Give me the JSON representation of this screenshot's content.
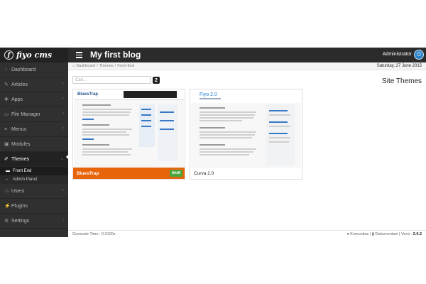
{
  "topbar": {
    "logo_text": "fiyo cms",
    "logo_mark": "f",
    "title": "My first blog",
    "user": "Administrator"
  },
  "sidebar": {
    "items": [
      {
        "label": "Dashboard",
        "icon": "dashboard-icon",
        "chevron": false
      },
      {
        "label": "Articles",
        "icon": "pencil-icon",
        "chevron": true
      },
      {
        "label": "Apps",
        "icon": "puzzle-icon",
        "chevron": true
      },
      {
        "label": "File Manager",
        "icon": "folder-icon",
        "chevron": true
      },
      {
        "label": "Menus",
        "icon": "list-icon",
        "chevron": true
      },
      {
        "label": "Modules",
        "icon": "cube-icon",
        "chevron": false
      },
      {
        "label": "Themes",
        "icon": "brush-icon",
        "chevron": true,
        "active": true
      },
      {
        "label": "Users",
        "icon": "user-icon",
        "chevron": true
      },
      {
        "label": "Plugins",
        "icon": "plug-icon",
        "chevron": false
      },
      {
        "label": "Settings",
        "icon": "gear-icon",
        "chevron": true
      }
    ],
    "subitems": [
      {
        "label": "Front End",
        "active": true
      },
      {
        "label": "Admin Panel",
        "active": false
      }
    ]
  },
  "breadcrumb": {
    "items": [
      "Dashboard",
      "Themes",
      "Front End"
    ],
    "date": "Saturday, 27 June 2015"
  },
  "search": {
    "placeholder": "Cari...",
    "count": "2"
  },
  "page": {
    "heading": "Site Themes"
  },
  "themes": [
    {
      "name": "BluesTrap",
      "badge": "Aktif",
      "thumb_logo": "BluesTrap",
      "active": true
    },
    {
      "name": "Curva 2.0",
      "badge": "",
      "thumb_logo": "Fiyo 2.0",
      "active": false
    }
  ],
  "footer": {
    "generate": "Generate Time : 0.0100s",
    "link1": "Komunitas",
    "link2": "Dokumentasi",
    "version_label": "Versi :",
    "version": "2.0.2"
  },
  "colors": {
    "accent": "#e8640a",
    "active_badge": "#4aa63a",
    "power": "#2a82c7"
  }
}
